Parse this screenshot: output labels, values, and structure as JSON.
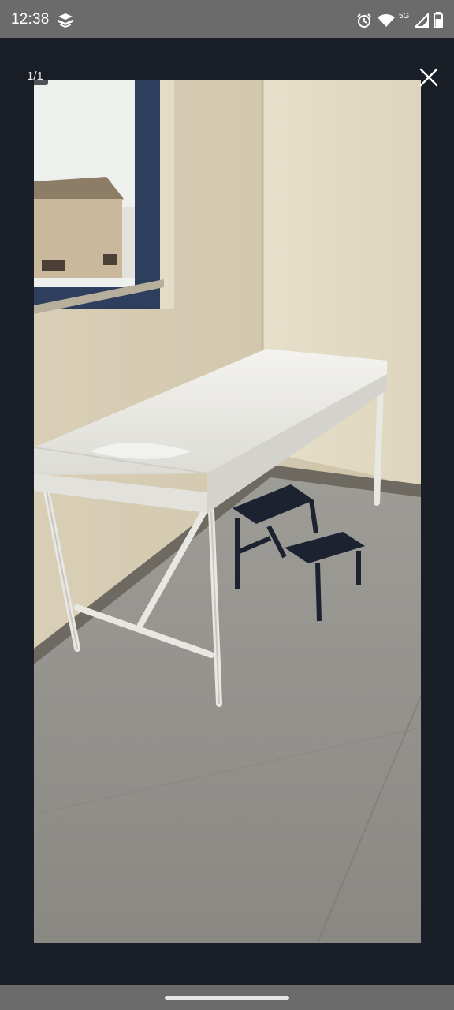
{
  "status_bar": {
    "time": "12:38",
    "network_type": "5G",
    "icons": [
      "stack-app-icon",
      "alarm-icon",
      "wifi-icon",
      "signal-icon",
      "battery-icon"
    ]
  },
  "viewer": {
    "counter": "1/1",
    "close_icon": "close-icon",
    "photo_subject": "exam-table-with-step-stool"
  },
  "colors": {
    "status_bar_bg": "#6b6b6b",
    "viewer_bg": "#1a1e26",
    "nav_bar_bg": "#6b6b6b"
  }
}
